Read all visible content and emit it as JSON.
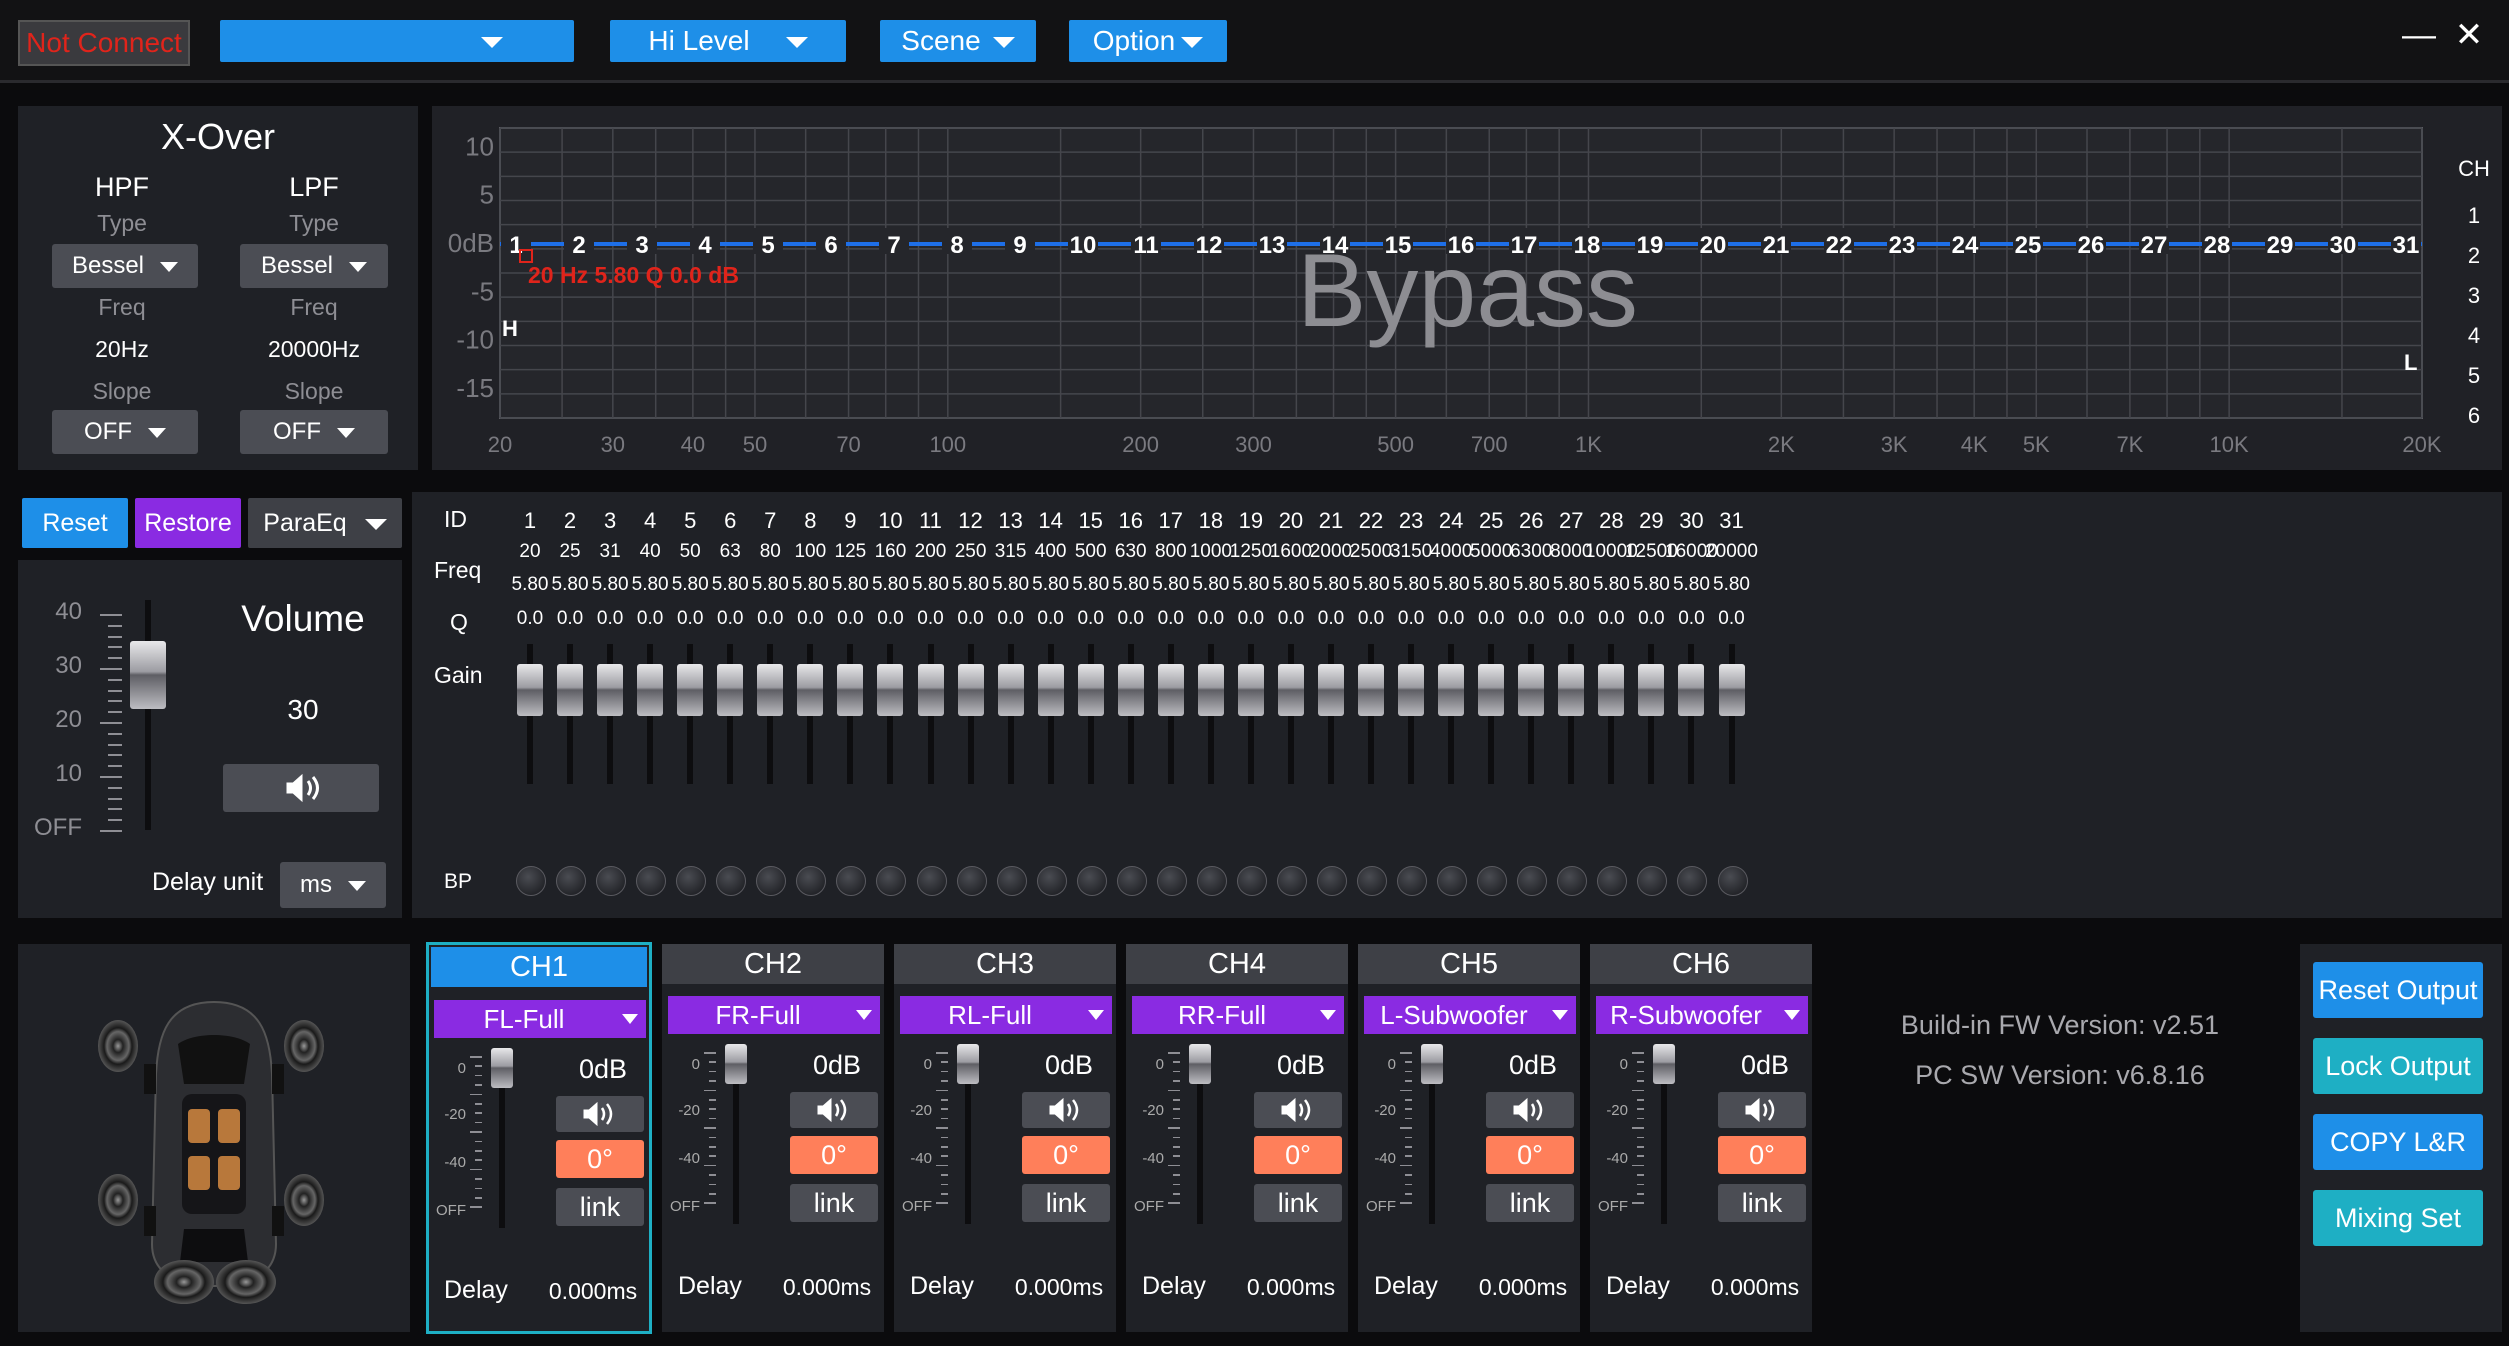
{
  "topbar": {
    "status": "Not Connect",
    "device_select": "",
    "input_level": "Hi Level",
    "scene_label": "Scene",
    "option_label": "Option",
    "minimize": "—",
    "close": "✕"
  },
  "xover": {
    "title": "X-Over",
    "hpf": {
      "label": "HPF",
      "type_label": "Type",
      "type": "Bessel",
      "freq_label": "Freq",
      "freq": "20Hz",
      "slope_label": "Slope",
      "slope": "OFF"
    },
    "lpf": {
      "label": "LPF",
      "type_label": "Type",
      "type": "Bessel",
      "freq_label": "Freq",
      "freq": "20000Hz",
      "slope_label": "Slope",
      "slope": "OFF"
    }
  },
  "graph": {
    "y_ticks": [
      "10",
      "5",
      "0dB",
      "-5",
      "-10",
      "-15"
    ],
    "x_ticks": [
      "20",
      "30",
      "40",
      "50",
      "70",
      "100",
      "200",
      "300",
      "500",
      "700",
      "1K",
      "2K",
      "3K",
      "4K",
      "5K",
      "7K",
      "10K",
      "20K"
    ],
    "bypass_text": "Bypass",
    "point_info": "20 Hz 5.80 Q 0.0 dB",
    "marker_h": "H",
    "marker_l": "L",
    "ch_label": "CH",
    "channels": [
      "1",
      "2",
      "3",
      "4",
      "5",
      "6"
    ],
    "band_labels": [
      "1",
      "2",
      "3",
      "4",
      "5",
      "6",
      "7",
      "8",
      "9",
      "10",
      "11",
      "12",
      "13",
      "14",
      "15",
      "16",
      "17",
      "18",
      "19",
      "20",
      "21",
      "22",
      "23",
      "24",
      "25",
      "26",
      "27",
      "28",
      "29",
      "30",
      "31"
    ],
    "line_color": "#1e6fe8"
  },
  "controls": {
    "reset": "Reset",
    "restore": "Restore",
    "mode": "ParaEq"
  },
  "volume": {
    "title": "Volume",
    "value": "30",
    "scale": [
      "40",
      "30",
      "20",
      "10",
      "OFF"
    ],
    "level_fraction": 0.75,
    "delay_unit_label": "Delay unit",
    "delay_unit": "ms"
  },
  "eq": {
    "row_labels": {
      "id": "ID",
      "freq": "Freq",
      "q": "Q",
      "gain": "Gain",
      "bp": "BP"
    },
    "ids": [
      "1",
      "2",
      "3",
      "4",
      "5",
      "6",
      "7",
      "8",
      "9",
      "10",
      "11",
      "12",
      "13",
      "14",
      "15",
      "16",
      "17",
      "18",
      "19",
      "20",
      "21",
      "22",
      "23",
      "24",
      "25",
      "26",
      "27",
      "28",
      "29",
      "30",
      "31"
    ],
    "freqs": [
      "20",
      "25",
      "31",
      "40",
      "50",
      "63",
      "80",
      "100",
      "125",
      "160",
      "200",
      "250",
      "315",
      "400",
      "500",
      "630",
      "800",
      "1000",
      "1250",
      "1600",
      "2000",
      "2500",
      "3150",
      "4000",
      "5000",
      "6300",
      "8000",
      "10000",
      "12500",
      "16000",
      "20000"
    ],
    "qs": [
      "5.80",
      "5.80",
      "5.80",
      "5.80",
      "5.80",
      "5.80",
      "5.80",
      "5.80",
      "5.80",
      "5.80",
      "5.80",
      "5.80",
      "5.80",
      "5.80",
      "5.80",
      "5.80",
      "5.80",
      "5.80",
      "5.80",
      "5.80",
      "5.80",
      "5.80",
      "5.80",
      "5.80",
      "5.80",
      "5.80",
      "5.80",
      "5.80",
      "5.80",
      "5.80",
      "5.80"
    ],
    "gains": [
      "0.0",
      "0.0",
      "0.0",
      "0.0",
      "0.0",
      "0.0",
      "0.0",
      "0.0",
      "0.0",
      "0.0",
      "0.0",
      "0.0",
      "0.0",
      "0.0",
      "0.0",
      "0.0",
      "0.0",
      "0.0",
      "0.0",
      "0.0",
      "0.0",
      "0.0",
      "0.0",
      "0.0",
      "0.0",
      "0.0",
      "0.0",
      "0.0",
      "0.0",
      "0.0",
      "0.0"
    ]
  },
  "channels": [
    {
      "name": "CH1",
      "output": "FL-Full",
      "gain": "0dB",
      "phase": "0°",
      "link": "link",
      "delay_label": "Delay",
      "delay": "0.000ms",
      "selected": true
    },
    {
      "name": "CH2",
      "output": "FR-Full",
      "gain": "0dB",
      "phase": "0°",
      "link": "link",
      "delay_label": "Delay",
      "delay": "0.000ms",
      "selected": false
    },
    {
      "name": "CH3",
      "output": "RL-Full",
      "gain": "0dB",
      "phase": "0°",
      "link": "link",
      "delay_label": "Delay",
      "delay": "0.000ms",
      "selected": false
    },
    {
      "name": "CH4",
      "output": "RR-Full",
      "gain": "0dB",
      "phase": "0°",
      "link": "link",
      "delay_label": "Delay",
      "delay": "0.000ms",
      "selected": false
    },
    {
      "name": "CH5",
      "output": "L-Subwoofer",
      "gain": "0dB",
      "phase": "0°",
      "link": "link",
      "delay_label": "Delay",
      "delay": "0.000ms",
      "selected": false
    },
    {
      "name": "CH6",
      "output": "R-Subwoofer",
      "gain": "0dB",
      "phase": "0°",
      "link": "link",
      "delay_label": "Delay",
      "delay": "0.000ms",
      "selected": false
    }
  ],
  "channel_scale": [
    "0",
    "-20",
    "-40",
    "OFF"
  ],
  "info": {
    "fw": "Build-in FW Version: v2.51",
    "sw": "PC SW Version: v6.8.16"
  },
  "output_buttons": {
    "reset": "Reset Output",
    "lock": "Lock Output",
    "copy": "COPY L&R",
    "mixing": "Mixing Set"
  },
  "colors": {
    "accent_blue": "#1e8fe8",
    "purple": "#8a2be2",
    "phase_orange": "#ff7f5a",
    "teal": "#1eafc4",
    "status_red": "#e0241b"
  }
}
